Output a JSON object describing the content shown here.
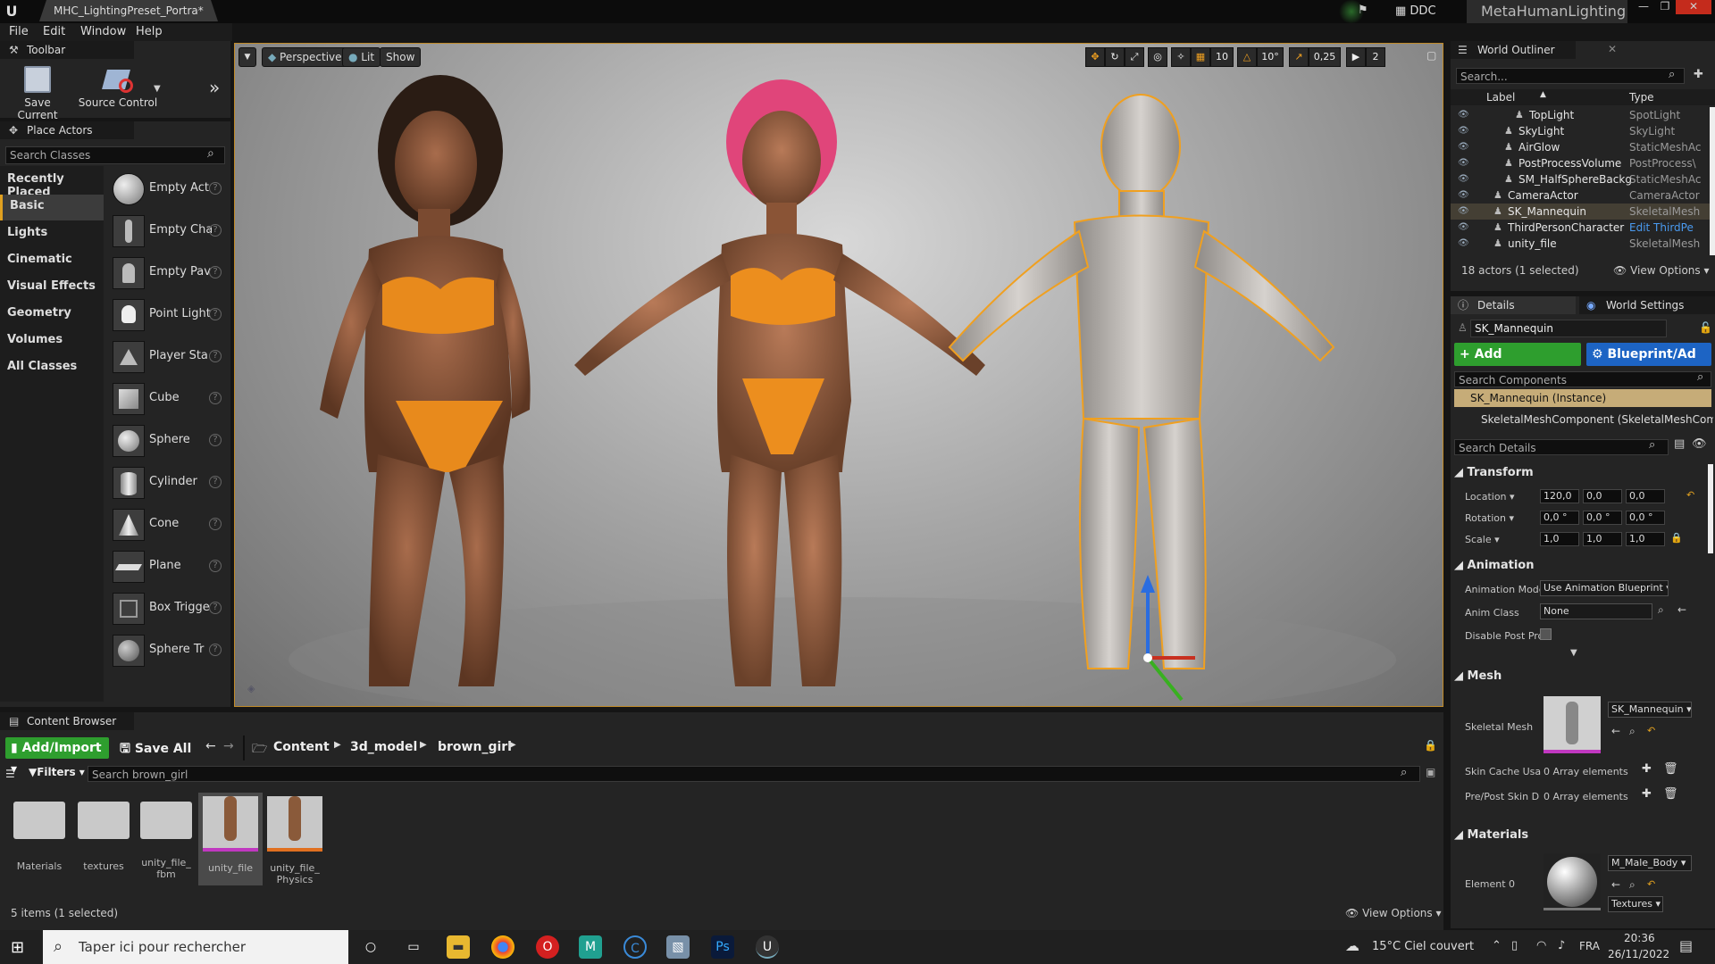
{
  "window": {
    "tab_title": "MHC_LightingPreset_Portra*",
    "ddc": "DDC",
    "project": "MetaHumanLighting"
  },
  "menu": [
    "File",
    "Edit",
    "Window",
    "Help"
  ],
  "toolbar": {
    "tab": "Toolbar",
    "save": "Save Current",
    "source_control": "Source Control"
  },
  "place_actors": {
    "tab": "Place Actors",
    "search_placeholder": "Search Classes",
    "categories": [
      "Recently Placed",
      "Basic",
      "Lights",
      "Cinematic",
      "Visual Effects",
      "Geometry",
      "Volumes",
      "All Classes"
    ],
    "active_category": "Basic",
    "actors": [
      "Empty Act",
      "Empty Cha",
      "Empty Pav",
      "Point Light",
      "Player Sta",
      "Cube",
      "Sphere",
      "Cylinder",
      "Cone",
      "Plane",
      "Box Trigge",
      "Sphere Tr"
    ]
  },
  "viewport": {
    "perspective": "Perspective",
    "lit": "Lit",
    "show": "Show",
    "grid": "10",
    "angle": "10°",
    "scale": "0,25",
    "cam_speed": "2"
  },
  "outliner": {
    "tab": "World Outliner",
    "search_placeholder": "Search...",
    "col_label": "Label",
    "col_type": "Type",
    "rows": [
      {
        "label": "TopLight",
        "type": "SpotLight",
        "indent": 2
      },
      {
        "label": "SkyLight",
        "type": "SkyLight",
        "indent": 1
      },
      {
        "label": "AirGlow",
        "type": "StaticMeshAc",
        "indent": 1
      },
      {
        "label": "PostProcessVolume",
        "type": "PostProcess\\",
        "indent": 1
      },
      {
        "label": "SM_HalfSphereBackg",
        "type": "StaticMeshAc",
        "indent": 1
      },
      {
        "label": "CameraActor",
        "type": "CameraActor",
        "indent": 0
      },
      {
        "label": "SK_Mannequin",
        "type": "SkeletalMesh",
        "indent": 0,
        "selected": true
      },
      {
        "label": "ThirdPersonCharacter",
        "type": "Edit ThirdPe",
        "indent": 0
      },
      {
        "label": "unity_file",
        "type": "SkeletalMesh",
        "indent": 0
      }
    ],
    "status": "18 actors (1 selected)",
    "view_options": "View Options"
  },
  "details": {
    "tab": "Details",
    "world_tab": "World Settings",
    "name": "SK_Mannequin",
    "add_component": "+ Add Component",
    "blueprint": "Blueprint/Ad",
    "search_components": "Search Components",
    "instance": "SK_Mannequin (Instance)",
    "component": "SkeletalMeshComponent (SkeletalMeshCompo",
    "search_details": "Search Details",
    "transform": "Transform",
    "location_label": "Location",
    "location": [
      "120,0",
      "0,0",
      "0,0"
    ],
    "rotation_label": "Rotation",
    "rotation": [
      "0,0 °",
      "0,0 °",
      "0,0 °"
    ],
    "scale_label": "Scale",
    "scale": [
      "1,0",
      "1,0",
      "1,0"
    ],
    "animation": "Animation",
    "anim_mode_label": "Animation Mode",
    "anim_mode": "Use Animation Blueprint",
    "anim_class_label": "Anim Class",
    "anim_class": "None",
    "disable_post_label": "Disable Post Prc",
    "mesh": "Mesh",
    "skeletal_mesh_label": "Skeletal Mesh",
    "skeletal_mesh": "SK_Mannequin",
    "skin_cache_label": "Skin Cache Usa",
    "skin_cache": "0 Array elements",
    "pre_post_label": "Pre/Post Skin D",
    "pre_post": "0 Array elements",
    "materials": "Materials",
    "element0_label": "Element 0",
    "element0": "M_Male_Body",
    "textures": "Textures"
  },
  "content_browser": {
    "tab": "Content Browser",
    "add_import": "Add/Import",
    "save_all": "Save All",
    "path": [
      "Content",
      "3d_model",
      "brown_girl"
    ],
    "filters": "Filters",
    "search_placeholder": "Search brown_girl",
    "assets": [
      {
        "name": "Materials",
        "kind": "folder"
      },
      {
        "name": "textures",
        "kind": "folder"
      },
      {
        "name": "unity_file_ fbm",
        "kind": "folder"
      },
      {
        "name": "unity_file",
        "kind": "mesh",
        "selected": true
      },
      {
        "name": "unity_file_ Physics",
        "kind": "physics"
      }
    ],
    "status": "5 items (1 selected)",
    "view_options": "View Options"
  },
  "taskbar": {
    "search": "Taper ici pour rechercher",
    "weather": "15°C  Ciel couvert",
    "lang": "FRA",
    "time": "20:36",
    "date": "26/11/2022"
  },
  "colors": {
    "accent_green": "#2e9e2e",
    "accent_blue": "#1d64c4",
    "selection": "#f0a020"
  }
}
